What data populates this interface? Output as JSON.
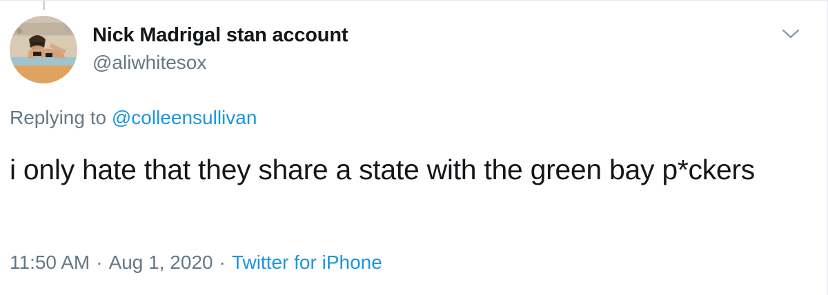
{
  "author": {
    "display_name": "Nick Madrigal stan account",
    "handle": "@aliwhitesox"
  },
  "reply": {
    "prefix": "Replying to ",
    "mention": "@colleensullivan"
  },
  "tweet": {
    "text": "i only hate that they share a state with the green bay p*ckers"
  },
  "meta": {
    "time": "11:50 AM",
    "separator": "·",
    "date": "Aug 1, 2020",
    "source": "Twitter for iPhone"
  },
  "icons": {
    "more_menu": "chevron-down-icon"
  },
  "colors": {
    "link": "#1b95e0",
    "secondary_text": "#657786",
    "primary_text": "#14171a",
    "border": "#e1e8ed"
  }
}
